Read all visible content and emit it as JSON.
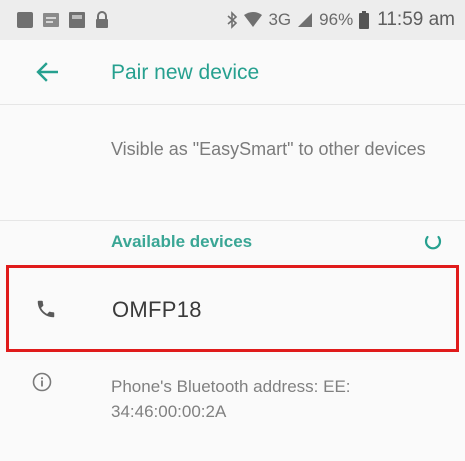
{
  "status_bar": {
    "network": "3G",
    "battery": "96%",
    "time": "11:59 am"
  },
  "app_bar": {
    "back_icon": "arrow-back-icon",
    "title": "Pair new device"
  },
  "visible_as": {
    "text": "Visible as \"EasySmart\" to other devices"
  },
  "available_devices": {
    "title": "Available devices",
    "refresh_icon": "refresh-spinner-icon",
    "items": [
      {
        "name": "OMFP18",
        "icon": "phone-icon"
      }
    ]
  },
  "info": {
    "icon": "info-icon",
    "text": "Phone's Bluetooth address: EE:\n34:46:00:00:2A"
  },
  "colors": {
    "accent": "#26a08f",
    "highlight_border": "#e01b1b",
    "status_bar_bg": "#ededed"
  }
}
